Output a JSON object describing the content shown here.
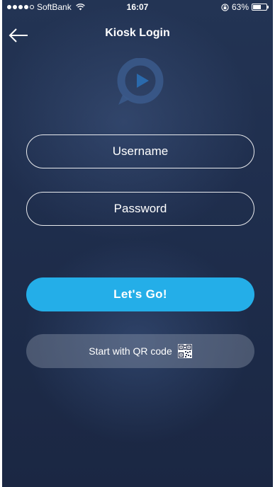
{
  "status_bar": {
    "carrier": "SoftBank",
    "time": "16:07",
    "battery_percent": "63%",
    "battery_level": 0.63,
    "icons": [
      "signal-dots",
      "wifi-icon",
      "orientation-lock-icon",
      "battery-icon"
    ]
  },
  "nav": {
    "title": "Kiosk Login",
    "back_icon": "back-arrow-icon"
  },
  "logo": {
    "icon": "play-chat-bubble-logo"
  },
  "form": {
    "username_placeholder": "Username",
    "password_placeholder": "Password",
    "submit_label": "Let's Go!",
    "qr_label": "Start with QR code",
    "qr_icon": "qr-code-icon"
  },
  "colors": {
    "background": "#1f2e4d",
    "primary_button": "#24aee8",
    "secondary_button": "#5b6780",
    "text": "#ffffff"
  }
}
